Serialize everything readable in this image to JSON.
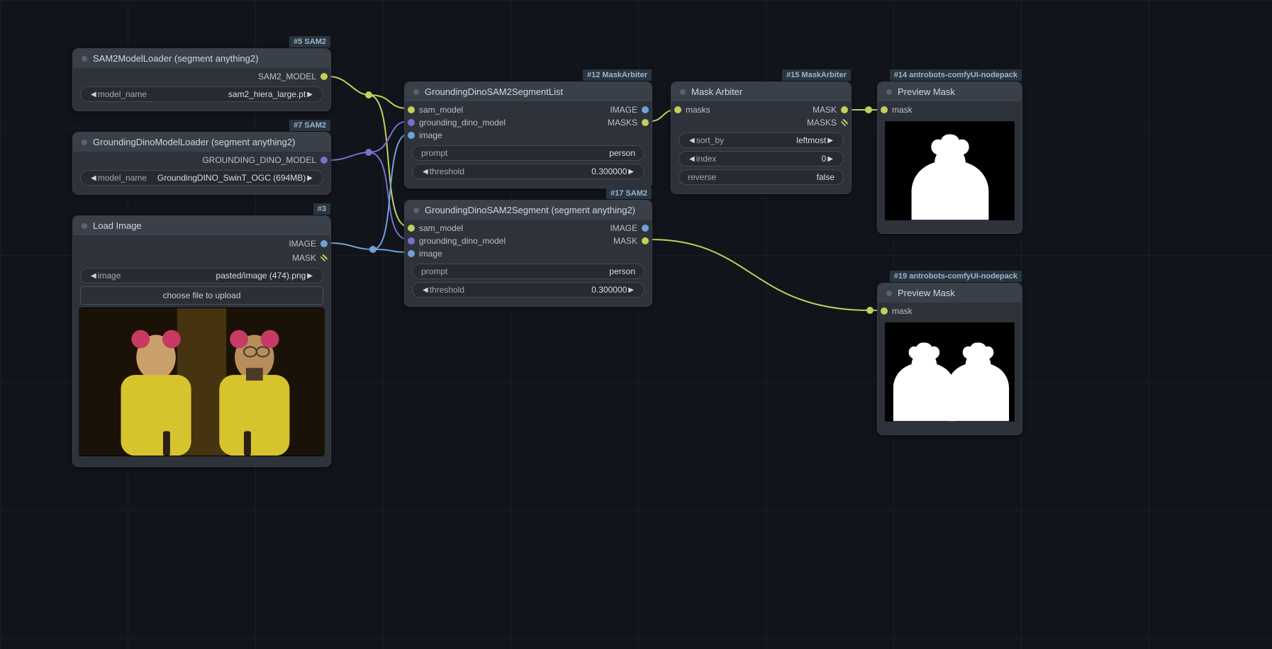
{
  "nodes": {
    "n5": {
      "tag": "#5 SAM2",
      "title": "SAM2ModelLoader (segment anything2)",
      "outputs": [
        {
          "label": "SAM2_MODEL"
        }
      ],
      "widgets": [
        {
          "kind": "combo",
          "label": "model_name",
          "value": "sam2_hiera_large.pt"
        }
      ]
    },
    "n7": {
      "tag": "#7 SAM2",
      "title": "GroundingDinoModelLoader (segment anything2)",
      "outputs": [
        {
          "label": "GROUNDING_DINO_MODEL"
        }
      ],
      "widgets": [
        {
          "kind": "combo",
          "label": "model_name",
          "value": "GroundingDINO_SwinT_OGC (694MB)"
        }
      ]
    },
    "n3": {
      "tag": "#3",
      "title": "Load Image",
      "outputs": [
        {
          "label": "IMAGE"
        },
        {
          "label": "MASK"
        }
      ],
      "widgets": [
        {
          "kind": "combo",
          "label": "image",
          "value": "pasted/image (474).png"
        },
        {
          "kind": "button",
          "label": "choose file to upload"
        }
      ]
    },
    "n12": {
      "tag": "#12 MaskArbiter",
      "title": "GroundingDinoSAM2SegmentList",
      "inputs": [
        {
          "label": "sam_model"
        },
        {
          "label": "grounding_dino_model"
        },
        {
          "label": "image"
        }
      ],
      "outputs": [
        {
          "label": "IMAGE"
        },
        {
          "label": "MASKS"
        }
      ],
      "widgets": [
        {
          "kind": "text",
          "label": "prompt",
          "value": "person"
        },
        {
          "kind": "number",
          "label": "threshold",
          "value": "0.300000"
        }
      ]
    },
    "n17": {
      "tag": "#17 SAM2",
      "title": "GroundingDinoSAM2Segment (segment anything2)",
      "inputs": [
        {
          "label": "sam_model"
        },
        {
          "label": "grounding_dino_model"
        },
        {
          "label": "image"
        }
      ],
      "outputs": [
        {
          "label": "IMAGE"
        },
        {
          "label": "MASK"
        }
      ],
      "widgets": [
        {
          "kind": "text",
          "label": "prompt",
          "value": "person"
        },
        {
          "kind": "number",
          "label": "threshold",
          "value": "0.300000"
        }
      ]
    },
    "n15": {
      "tag": "#15 MaskArbiter",
      "title": "Mask Arbiter",
      "inputs": [
        {
          "label": "masks"
        }
      ],
      "outputs": [
        {
          "label": "MASK"
        },
        {
          "label": "MASKS"
        }
      ],
      "widgets": [
        {
          "kind": "combo",
          "label": "sort_by",
          "value": "leftmost"
        },
        {
          "kind": "number",
          "label": "index",
          "value": "0"
        },
        {
          "kind": "bool",
          "label": "reverse",
          "value": "false"
        }
      ]
    },
    "n14": {
      "tag": "#14 antrobots-comfyUI-nodepack",
      "title": "Preview Mask",
      "inputs": [
        {
          "label": "mask"
        }
      ]
    },
    "n19": {
      "tag": "#19 antrobots-comfyUI-nodepack",
      "title": "Preview Mask",
      "inputs": [
        {
          "label": "mask"
        }
      ]
    }
  }
}
